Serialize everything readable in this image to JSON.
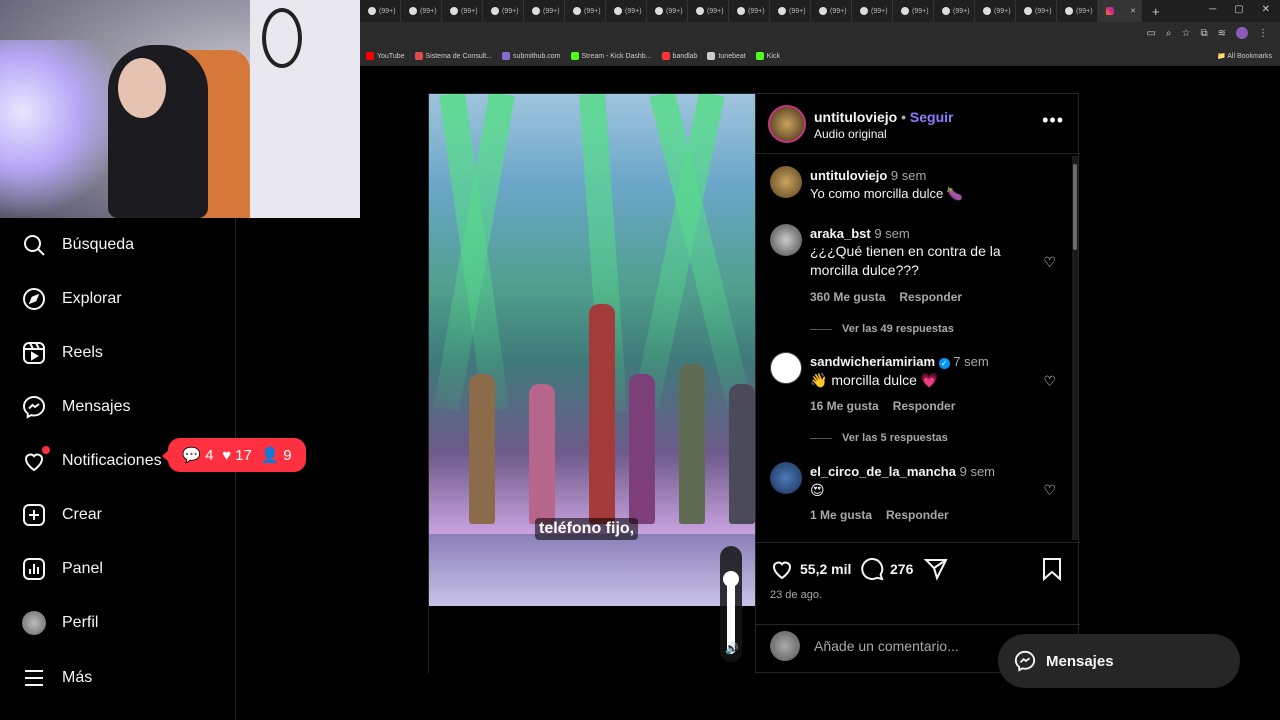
{
  "browser": {
    "tab_label": "(99+)",
    "tab_count": 18,
    "bookmarks": [
      {
        "label": "YouTube",
        "color": "#ff0000"
      },
      {
        "label": "Sistema de Consult...",
        "color": "#e34a4a"
      },
      {
        "label": "submithub.com",
        "color": "#8a6bd1"
      },
      {
        "label": "Stream - Kick Dashb...",
        "color": "#53fc18"
      },
      {
        "label": "bandlab",
        "color": "#f33"
      },
      {
        "label": "tunebeat",
        "color": "#ccc"
      },
      {
        "label": "Kick",
        "color": "#53fc18"
      }
    ],
    "all_bookmarks": "All Bookmarks"
  },
  "nav": {
    "items": [
      {
        "label": "Búsqueda",
        "icon": "search-icon"
      },
      {
        "label": "Explorar",
        "icon": "compass-icon"
      },
      {
        "label": "Reels",
        "icon": "reels-icon"
      },
      {
        "label": "Mensajes",
        "icon": "messenger-icon"
      },
      {
        "label": "Notificaciones",
        "icon": "heart-icon"
      },
      {
        "label": "Crear",
        "icon": "plus-square-icon"
      },
      {
        "label": "Panel",
        "icon": "dashboard-icon"
      },
      {
        "label": "Perfil",
        "icon": "avatar"
      },
      {
        "label": "Más",
        "icon": "menu-icon"
      }
    ],
    "badge": {
      "comments": "4",
      "likes": "17",
      "follows": "9"
    }
  },
  "post": {
    "subtitle": "teléfono fijo,",
    "volume_level": 0.75,
    "header": {
      "username": "untituloviejo",
      "dot": "•",
      "follow": "Seguir",
      "audio": "Audio original",
      "more": "•••"
    },
    "comments": [
      {
        "user": "untituloviejo",
        "time": "9 sem",
        "text": "Yo como morcilla dulce 🍆",
        "likes": "",
        "reply": "",
        "replies": ""
      },
      {
        "user": "araka_bst",
        "time": "9 sem",
        "text": "¿¿¿Qué tienen en contra de la morcilla dulce???",
        "likes": "360 Me gusta",
        "reply": "Responder",
        "replies": "Ver las 49 respuestas"
      },
      {
        "user": "sandwicheriamiriam",
        "time": "7 sem",
        "text": "👋 morcilla dulce 💗",
        "likes": "16 Me gusta",
        "reply": "Responder",
        "replies": "Ver las 5 respuestas"
      },
      {
        "user": "el_circo_de_la_mancha",
        "time": "9 sem",
        "text": "😍",
        "likes": "1 Me gusta",
        "reply": "Responder",
        "replies": ""
      }
    ],
    "actions": {
      "likes": "55,2 mil",
      "comments": "276",
      "date": "23 de ago."
    },
    "add_comment_placeholder": "Añade un comentario..."
  },
  "messages_pill": "Mensajes",
  "colors": {
    "accent": "#8c7dff",
    "notification": "#ff3040",
    "verified": "#0095f6"
  }
}
